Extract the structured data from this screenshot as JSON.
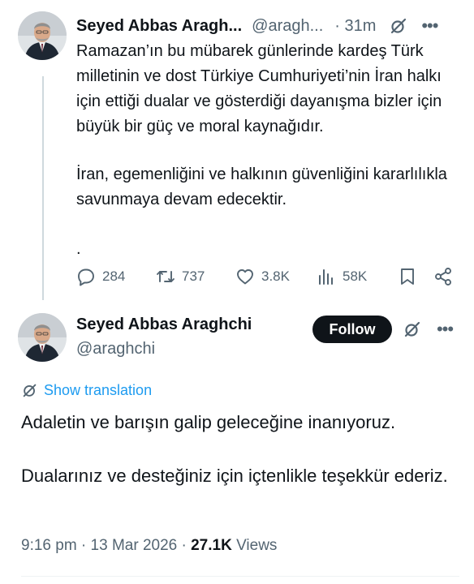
{
  "tweet1": {
    "name": "Seyed Abbas Aragh...",
    "handle": "@aragh...",
    "time": "· 31m",
    "body": {
      "paragraph1": "Ramazan’ın bu mübarek günlerinde kardeş Türk milletinin ve dost Türkiye Cumhuriyeti’nin İran halkı için ettiği dualar ve gösterdiği dayanışma bizler için büyük bir güç ve moral kaynağıdır.",
      "paragraph2": "İran, egemenliğini ve halkının güvenliğini kararlılıkla savunmaya devam edecektir.",
      "paragraph3": "."
    },
    "actions": {
      "replies": "284",
      "reposts": "737",
      "likes": "3.8K",
      "views": "58K"
    }
  },
  "tweet2": {
    "name": "Seyed Abbas Araghchi",
    "handle": "@araghchi",
    "follow_label": "Follow",
    "show_translation": "Show translation",
    "body": {
      "paragraph1": "Adaletin ve barışın galip geleceğine inanıyoruz.",
      "paragraph2": "Dualarınız ve desteğiniz için içtenlikle teşekkür ederiz."
    },
    "meta": {
      "datetime": "9:16 pm · 13 Mar 2026 · ",
      "views_count": "27.1K",
      "views_label": " Views"
    }
  },
  "icons": {
    "reply": "reply-icon",
    "repost": "repost-icon",
    "like": "like-icon",
    "views": "views-icon",
    "bookmark": "bookmark-icon",
    "share": "share-icon",
    "grok": "grok-icon",
    "more": "more-icon"
  },
  "colors": {
    "text_primary": "#0f1419",
    "text_secondary": "#536471",
    "link": "#1d9bf0",
    "follow_bg": "#0f1419"
  }
}
